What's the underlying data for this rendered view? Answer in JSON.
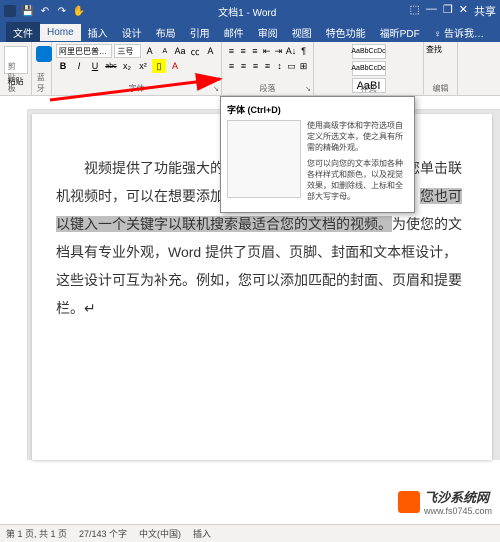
{
  "titlebar": {
    "title": "文档1 - Word",
    "min": "—",
    "restore": "❐",
    "close": "✕",
    "ribbonToggle": "⬚",
    "share": "共享"
  },
  "qat": {
    "save": "💾",
    "undo": "↶",
    "redo": "↷",
    "touch": "✋"
  },
  "tabs": {
    "file": "文件",
    "home": "Home",
    "insert": "插入",
    "design": "设计",
    "layout": "布局",
    "references": "引用",
    "mailings": "邮件",
    "review": "审阅",
    "view": "视图",
    "special": "特色功能",
    "foxit": "福昕PDF",
    "tell": "♀ 告诉我…"
  },
  "ribbon": {
    "clipboard": {
      "label": "剪贴板",
      "paste": "粘贴",
      "cut": "✂"
    },
    "bt": {
      "label": "蓝牙"
    },
    "font": {
      "label": "字体",
      "family": "阿里巴巴普…",
      "size": "三号",
      "inc": "A",
      "dec": "A",
      "clear": "Aa",
      "phonetic": "㏄",
      "border": "A",
      "bold": "B",
      "italic": "I",
      "underline": "U",
      "strike": "abc",
      "sub": "x₂",
      "sup": "x²",
      "hl": "▯",
      "color": "A",
      "launcher": "↘"
    },
    "paragraph": {
      "label": "段落",
      "bullets": "≡",
      "numbers": "≡",
      "multi": "≡",
      "indentL": "⇤",
      "indentR": "⇥",
      "sort": "A↓",
      "show": "¶",
      "alignL": "≡",
      "alignC": "≡",
      "alignR": "≡",
      "justify": "≡",
      "spacing": "↕",
      "shading": "▭",
      "borders": "⊞",
      "launcher": "↘"
    },
    "styles": {
      "label": "样式",
      "s1": "AaBbCcDc",
      "s2": "AaBbCcDc",
      "s3": "AaBI"
    },
    "editing": {
      "label": "编辑",
      "find": "查找"
    }
  },
  "tooltip": {
    "title": "字体 (Ctrl+D)",
    "p1": "使用高级字体和字符选项自定义所选文本，使之具有所需的精确外观。",
    "p2": "您可以向您的文本添加各种各样样式和颜色，以及视觉效果，如删除线、上标和全部大写字母。"
  },
  "document": {
    "t1": "视频提供了功能强大的方法帮助您证明您的观点。当您单击联机视频时，可以在想要添加的视频的嵌入代码中进行粘贴。",
    "hl": "您也可以键入一个关键字以联机搜索最适合您的文档的视频。",
    "t2": "为使您的文档具有专业外观，Word 提供了页眉、页脚、封面和文本框设计，这些设计可互为补充。例如，您可以添加匹配的封面、页眉和提要栏。"
  },
  "status": {
    "page": "第 1 页, 共 1 页",
    "words": "27/143 个字",
    "lang": "中文(中国)",
    "ins": "插入"
  },
  "watermark": {
    "brand": "飞沙系统网",
    "url": "www.fs0745.com"
  }
}
